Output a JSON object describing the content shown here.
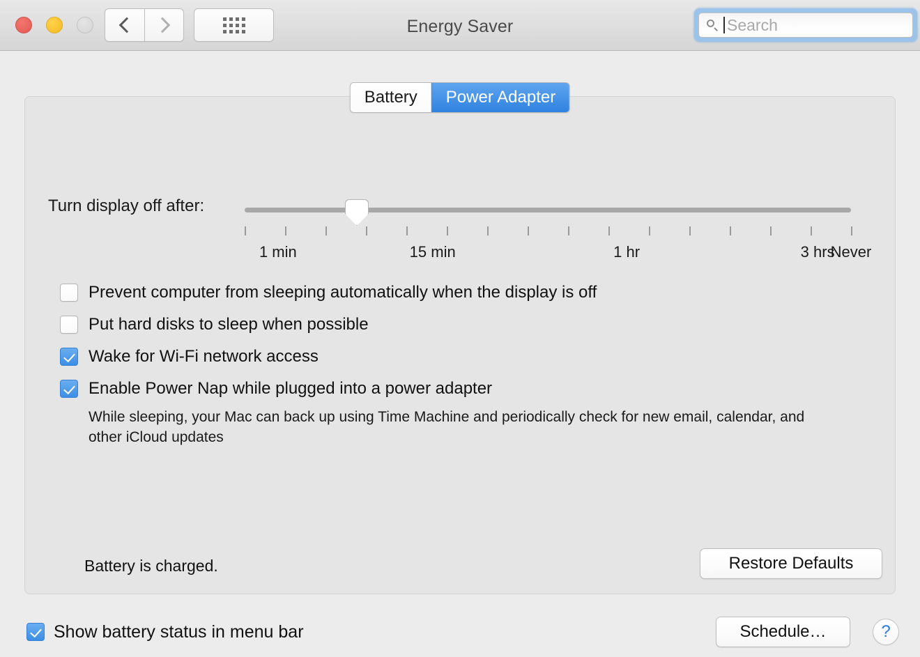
{
  "window": {
    "title": "Energy Saver",
    "traffic_lights": [
      {
        "name": "close",
        "color": "#e8625a"
      },
      {
        "name": "minimize",
        "color": "#f7c12e"
      },
      {
        "name": "zoom",
        "color": "#dadada"
      }
    ],
    "nav": {
      "back_icon": "chevron-left-icon",
      "forward_icon": "chevron-right-icon"
    },
    "grid_icon": "show-all-grid-icon"
  },
  "search": {
    "icon": "search-icon",
    "placeholder": "Search",
    "value": "",
    "focused": true
  },
  "tabs": [
    {
      "label": "Battery",
      "selected": false
    },
    {
      "label": "Power Adapter",
      "selected": true
    }
  ],
  "slider": {
    "label": "Turn display off after:",
    "value_position_pct": 18.5,
    "tick_count": 16,
    "tick_labels": [
      {
        "text": "1 min",
        "pos_pct": 5.5
      },
      {
        "text": "15 min",
        "pos_pct": 31.0
      },
      {
        "text": "1 hr",
        "pos_pct": 63.0
      },
      {
        "text": "3 hrs",
        "pos_pct": 94.5
      },
      {
        "text": "Never",
        "pos_pct": 100.0
      }
    ]
  },
  "checkboxes": [
    {
      "label": "Prevent computer from sleeping automatically when the display is off",
      "checked": false
    },
    {
      "label": "Put hard disks to sleep when possible",
      "checked": false
    },
    {
      "label": "Wake for Wi-Fi network access",
      "checked": true
    },
    {
      "label": "Enable Power Nap while plugged into a power adapter",
      "checked": true
    }
  ],
  "power_nap_description": "While sleeping, your Mac can back up using Time Machine and periodically check for new email, calendar, and other iCloud updates",
  "battery_status": "Battery is charged.",
  "buttons": {
    "restore_defaults": "Restore Defaults",
    "schedule": "Schedule…",
    "help": "?"
  },
  "menu_bar_option": {
    "label": "Show battery status in menu bar",
    "checked": true
  },
  "colors": {
    "accent_blue": "#3d8ee5",
    "tab_selected": "#2f82e0",
    "help_blue": "#2b7ce0",
    "window_bg": "#ececec",
    "panel_bg": "#e5e5e5"
  }
}
